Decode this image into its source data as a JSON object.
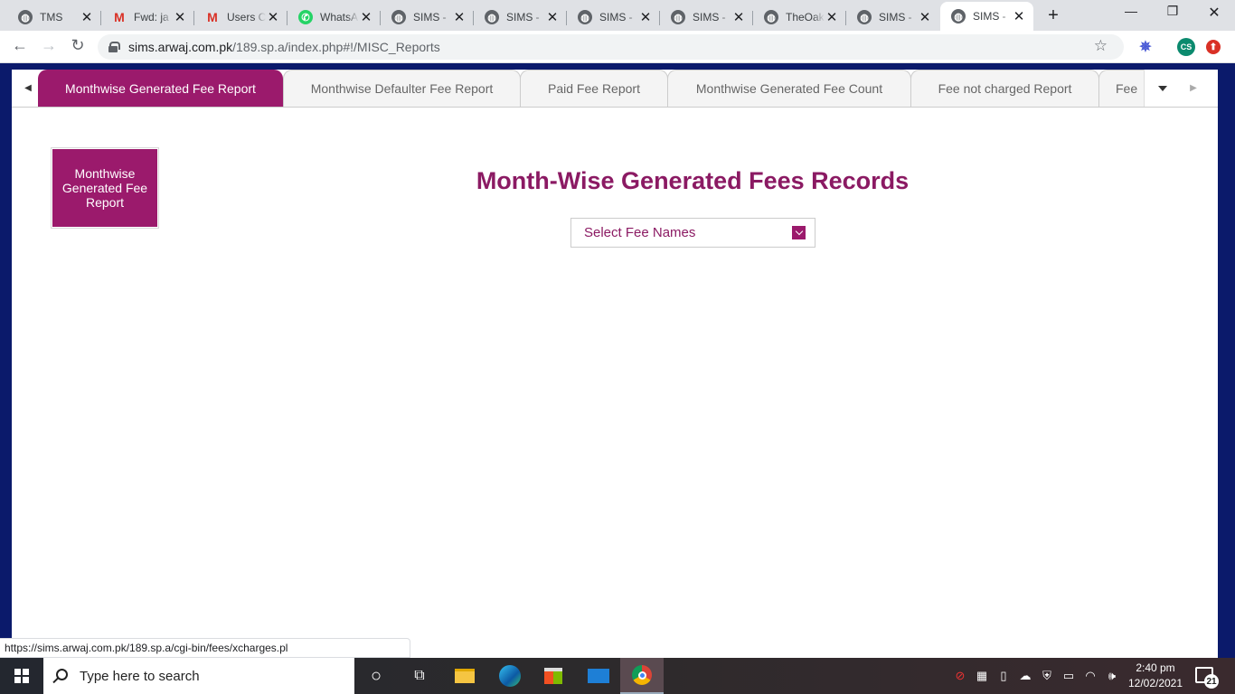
{
  "browser": {
    "tabs": [
      {
        "title": "TMS",
        "icon": "globe-icon"
      },
      {
        "title": "Fwd: ja",
        "icon": "gmail-icon"
      },
      {
        "title": "Users C",
        "icon": "gmail-icon"
      },
      {
        "title": "WhatsA",
        "icon": "whatsapp-icon"
      },
      {
        "title": "SIMS -",
        "icon": "globe-icon"
      },
      {
        "title": "SIMS -",
        "icon": "globe-icon"
      },
      {
        "title": "SIMS -",
        "icon": "globe-icon"
      },
      {
        "title": "SIMS -",
        "icon": "globe-icon"
      },
      {
        "title": "TheOak",
        "icon": "globe-icon"
      },
      {
        "title": "SIMS -",
        "icon": "globe-icon"
      },
      {
        "title": "SIMS -",
        "icon": "globe-icon"
      }
    ],
    "active_tab": 10,
    "url_host": "sims.arwaj.com.pk",
    "url_path": "/189.sp.a/index.php#!/MISC_Reports",
    "profile_initials": "CS",
    "status_url": "https://sims.arwaj.com.pk/189.sp.a/cgi-bin/fees/xcharges.pl"
  },
  "reports": {
    "tabs": [
      "Monthwise Generated Fee Report",
      "Monthwise Defaulter Fee Report",
      "Paid Fee Report",
      "Monthwise Generated Fee Count",
      "Fee not charged Report",
      "Fee"
    ],
    "active_tab": 0,
    "side_button": "Monthwise Generated Fee Report",
    "heading": "Month-Wise Generated Fees Records",
    "select_placeholder": "Select Fee Names"
  },
  "taskbar": {
    "search_placeholder": "Type here to search",
    "time": "2:40 pm",
    "date": "12/02/2021",
    "notification_count": "21"
  },
  "colors": {
    "brand": "#9b1a6c",
    "heading": "#8b1a63",
    "desktop": "#0b1a6b"
  }
}
